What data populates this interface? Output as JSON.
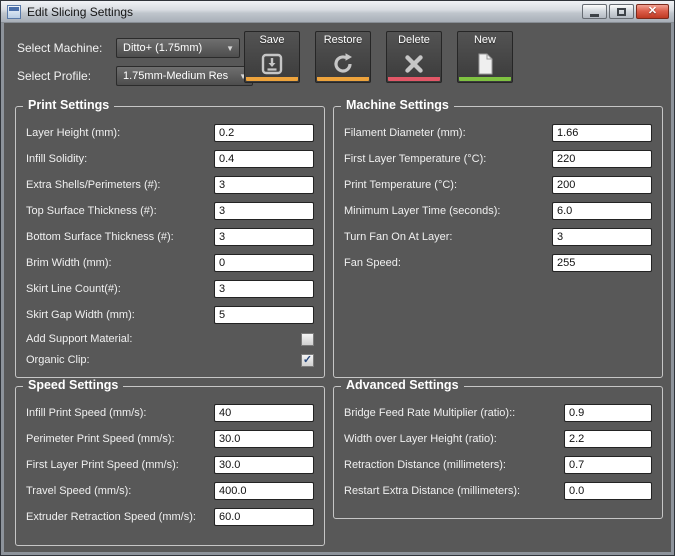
{
  "window": {
    "title": "Edit Slicing Settings",
    "controls": {
      "close": "✕"
    }
  },
  "icons": {
    "dropdown_arrow": "▼",
    "check": "✓",
    "toolbar_icon_color": "#c6c6c6"
  },
  "header": {
    "machine_label": "Select Machine:",
    "machine_value": "Ditto+ (1.75mm)",
    "profile_label": "Select Profile:",
    "profile_value": "1.75mm-Medium Res"
  },
  "toolbar": {
    "buttons": [
      {
        "label": "Save",
        "icon": "save-icon",
        "accent": "#eda33c"
      },
      {
        "label": "Restore",
        "icon": "restore-icon",
        "accent": "#eda33c"
      },
      {
        "label": "Delete",
        "icon": "delete-icon",
        "accent": "#e25767"
      },
      {
        "label": "New",
        "icon": "new-icon",
        "accent": "#7fc241"
      }
    ]
  },
  "groups": {
    "print": {
      "title": "Print Settings",
      "fields": [
        {
          "label": "Layer Height (mm):",
          "value": "0.2"
        },
        {
          "label": "Infill Solidity:",
          "value": "0.4"
        },
        {
          "label": "Extra Shells/Perimeters (#):",
          "value": "3"
        },
        {
          "label": "Top Surface Thickness (#):",
          "value": "3"
        },
        {
          "label": "Bottom Surface Thickness (#):",
          "value": "3"
        },
        {
          "label": "Brim Width (mm):",
          "value": "0"
        },
        {
          "label": "Skirt Line Count(#):",
          "value": "3"
        },
        {
          "label": "Skirt Gap Width (mm):",
          "value": "5"
        }
      ],
      "checkboxes": [
        {
          "label": "Add Support Material:",
          "checked": false,
          "glyph": ""
        },
        {
          "label": "Organic Clip:",
          "checked": true,
          "glyph": "✓"
        }
      ]
    },
    "machine": {
      "title": "Machine Settings",
      "fields": [
        {
          "label": "Filament Diameter (mm):",
          "value": "1.66"
        },
        {
          "label": "First Layer Temperature (°C):",
          "value": "220"
        },
        {
          "label": "Print Temperature (°C):",
          "value": "200"
        },
        {
          "label": "Minimum Layer Time (seconds):",
          "value": "6.0"
        },
        {
          "label": "Turn Fan On At Layer:",
          "value": "3"
        },
        {
          "label": "Fan Speed:",
          "value": "255"
        }
      ]
    },
    "speed": {
      "title": "Speed Settings",
      "fields": [
        {
          "label": "Infill Print Speed (mm/s):",
          "value": "40"
        },
        {
          "label": "Perimeter Print Speed (mm/s):",
          "value": "30.0"
        },
        {
          "label": "First Layer Print Speed (mm/s):",
          "value": "30.0"
        },
        {
          "label": "Travel Speed (mm/s):",
          "value": "400.0"
        },
        {
          "label": "Extruder Retraction Speed (mm/s):",
          "value": "60.0"
        }
      ]
    },
    "advanced": {
      "title": "Advanced Settings",
      "fields": [
        {
          "label": "Bridge Feed Rate Multiplier (ratio)::",
          "value": "0.9"
        },
        {
          "label": "Width over Layer Height (ratio):",
          "value": "2.2"
        },
        {
          "label": "Retraction Distance (millimeters):",
          "value": "0.7"
        },
        {
          "label": "Restart Extra Distance (millimeters):",
          "value": "0.0"
        }
      ]
    }
  }
}
